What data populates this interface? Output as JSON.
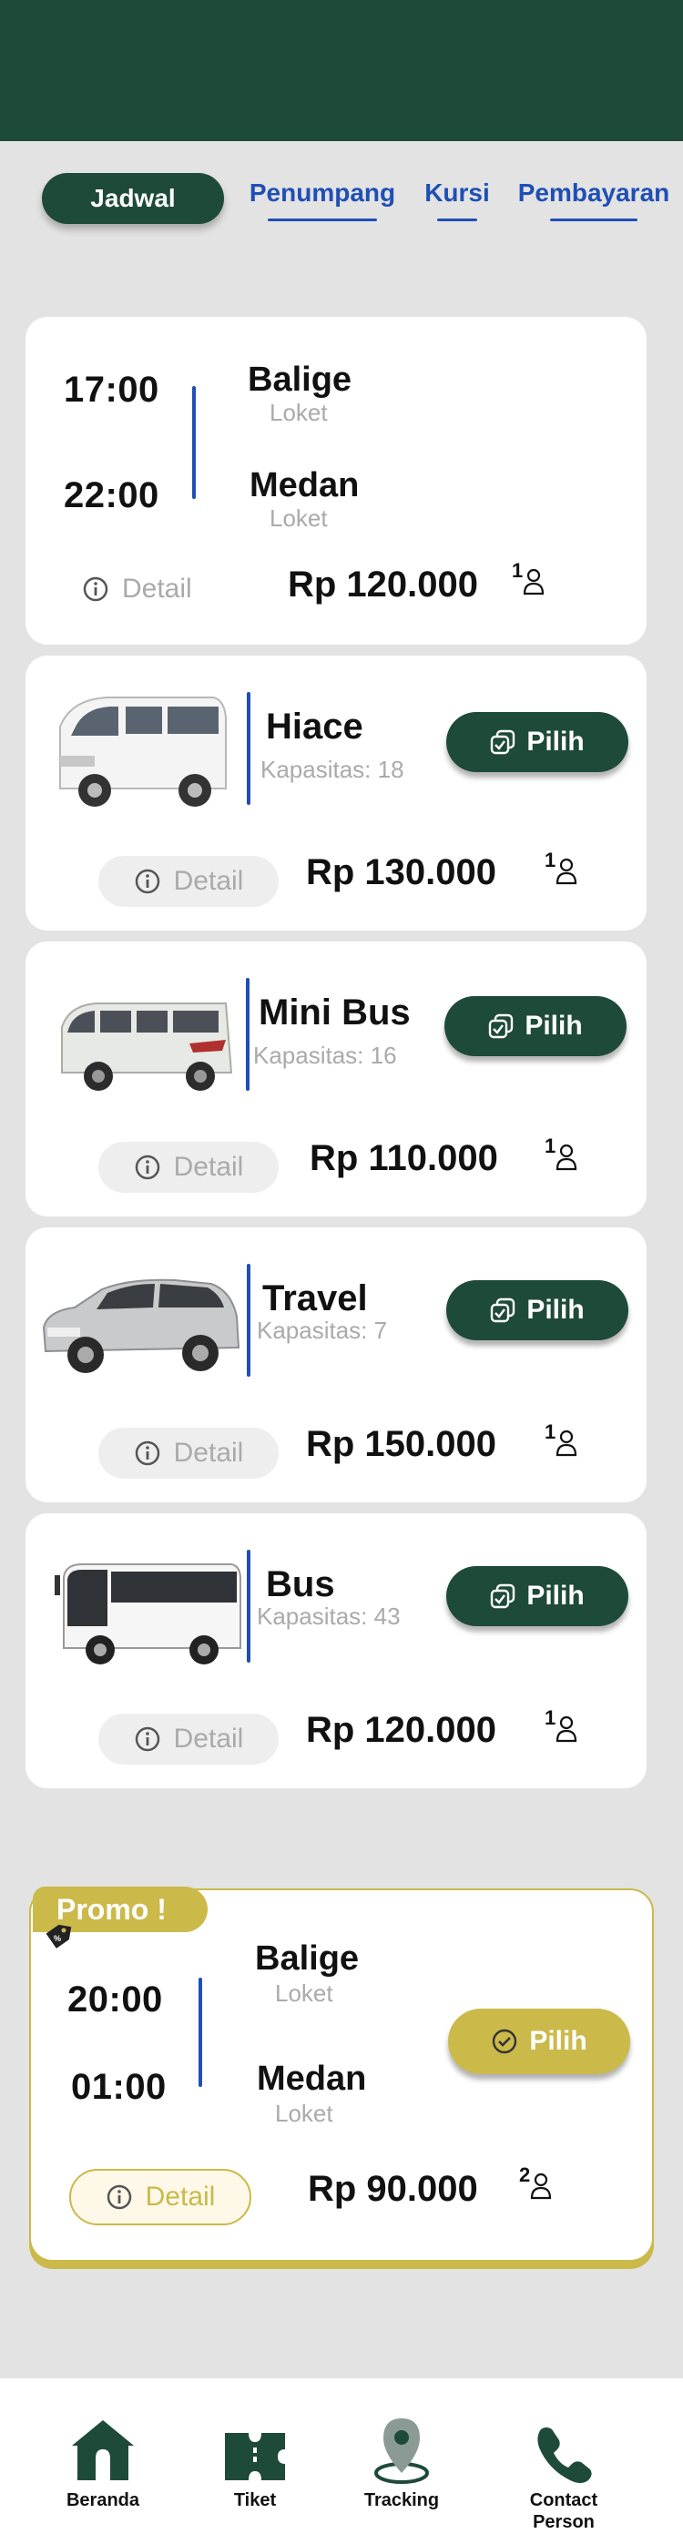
{
  "tabs": {
    "active": "Jadwal",
    "items": [
      "Penumpang",
      "Kursi",
      "Pembayaran"
    ]
  },
  "route_card": {
    "depart_time": "17:00",
    "depart_city": "Balige",
    "depart_place": "Loket",
    "arrive_time": "22:00",
    "arrive_city": "Medan",
    "arrive_place": "Loket",
    "detail_label": "Detail",
    "price": "Rp 120.000",
    "passengers": "1"
  },
  "vehicles": [
    {
      "name": "Hiace",
      "capacity": "Kapasitas: 18",
      "price": "Rp 130.000",
      "passengers": "1",
      "detail_label": "Detail",
      "button_label": "Pilih",
      "image_icon": "hiace-van-image"
    },
    {
      "name": "Mini Bus",
      "capacity": "Kapasitas: 16",
      "price": "Rp 110.000",
      "passengers": "1",
      "detail_label": "Detail",
      "button_label": "Pilih",
      "image_icon": "minibus-image"
    },
    {
      "name": "Travel",
      "capacity": "Kapasitas: 7",
      "price": "Rp 150.000",
      "passengers": "1",
      "detail_label": "Detail",
      "button_label": "Pilih",
      "image_icon": "mpv-car-image"
    },
    {
      "name": "Bus",
      "capacity": "Kapasitas: 43",
      "price": "Rp 120.000",
      "passengers": "1",
      "detail_label": "Detail",
      "button_label": "Pilih",
      "image_icon": "bus-image"
    }
  ],
  "promo": {
    "badge": "Promo !",
    "depart_time": "20:00",
    "depart_city": "Balige",
    "depart_place": "Loket",
    "arrive_time": "01:00",
    "arrive_city": "Medan",
    "arrive_place": "Loket",
    "detail_label": "Detail",
    "price": "Rp 90.000",
    "passengers": "2",
    "button_label": "Pilih"
  },
  "bottom_nav": [
    "Beranda",
    "Tiket",
    "Tracking",
    "Contact Person"
  ],
  "colors": {
    "primary": "#1e4a3a",
    "accent_blue": "#1f4fb5",
    "gold": "#cbb94a",
    "background": "#e3e3e3"
  }
}
